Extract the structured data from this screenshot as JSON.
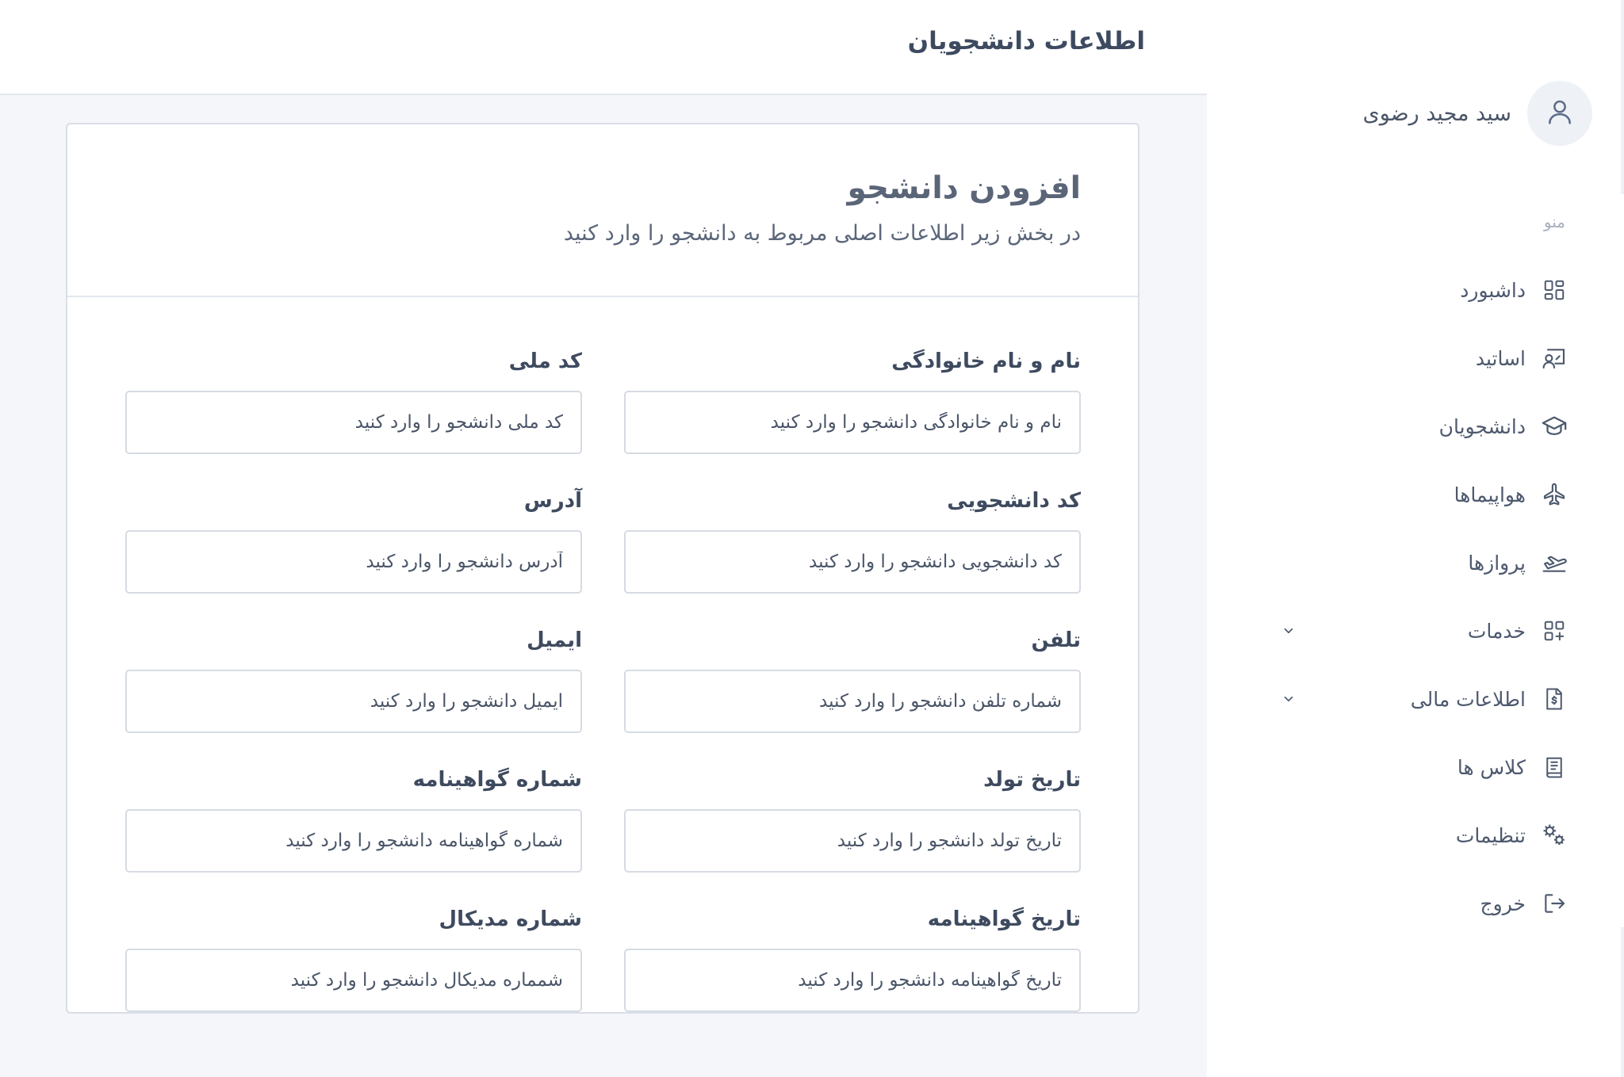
{
  "header": {
    "title": "اطلاعات دانشجویان"
  },
  "profile": {
    "name": "سید مجید رضوی",
    "icon": "user-icon"
  },
  "menu": {
    "caption": "منو",
    "items": [
      {
        "label": "داشبورد",
        "icon": "dashboard-icon",
        "has_chevron": false
      },
      {
        "label": "اساتید",
        "icon": "teacher-icon",
        "has_chevron": false
      },
      {
        "label": "دانشجویان",
        "icon": "graduation-cap-icon",
        "has_chevron": false
      },
      {
        "label": "هواپیماها",
        "icon": "airplane-icon",
        "has_chevron": false
      },
      {
        "label": "پروازها",
        "icon": "flight-takeoff-icon",
        "has_chevron": false
      },
      {
        "label": "خدمات",
        "icon": "apps-add-icon",
        "has_chevron": true
      },
      {
        "label": "اطلاعات مالی",
        "icon": "invoice-icon",
        "has_chevron": true
      },
      {
        "label": "کلاس ها",
        "icon": "book-icon",
        "has_chevron": false
      },
      {
        "label": "تنظیمات",
        "icon": "gears-icon",
        "has_chevron": false
      },
      {
        "label": "خروج",
        "icon": "logout-icon",
        "has_chevron": false
      }
    ]
  },
  "card": {
    "title": "افزودن دانشجو",
    "subtitle": "در بخش زیر اطلاعات اصلی مربوط به دانشجو را وارد کنید",
    "fields": [
      {
        "label": "نام و نام خانوادگی",
        "placeholder": "نام و نام خانوادگی دانشجو را وارد کنید",
        "value": ""
      },
      {
        "label": "کد ملی",
        "placeholder": "کد ملی دانشجو را وارد کنید",
        "value": ""
      },
      {
        "label": "کد دانشجویی",
        "placeholder": "کد دانشجویی دانشجو را وارد کنید",
        "value": ""
      },
      {
        "label": "آدرس",
        "placeholder": "آدرس دانشجو را وارد کنید",
        "value": ""
      },
      {
        "label": "تلفن",
        "placeholder": "شماره تلفن دانشجو را وارد کنید",
        "value": ""
      },
      {
        "label": "ایمیل",
        "placeholder": "ایمیل دانشجو را وارد کنید",
        "value": ""
      },
      {
        "label": "تاریخ تولد",
        "placeholder": "تاریخ تولد دانشجو را وارد کنید",
        "value": ""
      },
      {
        "label": "شماره گواهینامه",
        "placeholder": "شماره گواهینامه دانشجو را وارد کنید",
        "value": ""
      },
      {
        "label": "تاریخ گواهینامه",
        "placeholder": "تاریخ گواهینامه دانشجو را وارد کنید",
        "value": ""
      },
      {
        "label": "شماره مدیکال",
        "placeholder": "شمماره مدیکال دانشجو را وارد کنید",
        "value": ""
      }
    ]
  },
  "colors": {
    "text": "#3f4b62",
    "muted": "#a6afbd",
    "border": "#d6dbe3",
    "background": "#f4f6f9",
    "icon": "#4d596e"
  }
}
